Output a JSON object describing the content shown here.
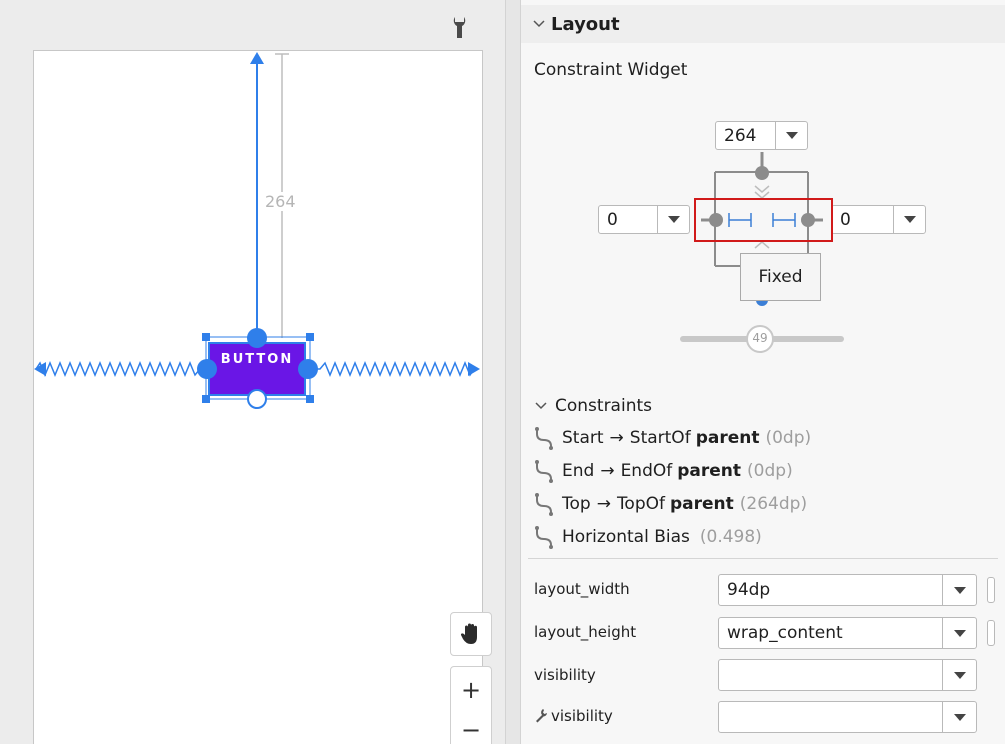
{
  "canvas": {
    "top_margin_value": "264",
    "widget_label": "BUTTON",
    "tools": {
      "pan": "hand-icon",
      "zoom_in": "+",
      "zoom_out": "−",
      "settings": "wrench-icon"
    }
  },
  "panel": {
    "section_title": "Layout",
    "widget_title": "Constraint Widget",
    "inspector": {
      "top_margin": "264",
      "start_margin": "0",
      "end_margin": "0",
      "bias_value": "49",
      "tooltip": "Fixed"
    },
    "constraints": {
      "title": "Constraints",
      "items": [
        {
          "anchor": "Start",
          "arrow": "→",
          "target": "StartOf",
          "parent": "parent",
          "value": "(0dp)"
        },
        {
          "anchor": "End",
          "arrow": "→",
          "target": "EndOf",
          "parent": "parent",
          "value": "(0dp)"
        },
        {
          "anchor": "Top",
          "arrow": "→",
          "target": "TopOf",
          "parent": "parent",
          "value": "(264dp)"
        },
        {
          "anchor": "Horizontal Bias",
          "arrow": "",
          "target": "",
          "parent": "",
          "value": "(0.498)"
        }
      ]
    },
    "attributes": [
      {
        "label": "layout_width",
        "value": "94dp"
      },
      {
        "label": "layout_height",
        "value": "wrap_content"
      },
      {
        "label": "visibility",
        "value": ""
      },
      {
        "label": "visibility",
        "value": ""
      }
    ]
  },
  "colors": {
    "accent": "#2f7fea",
    "widget": "#6a16e6",
    "highlight": "#d11a1a"
  }
}
